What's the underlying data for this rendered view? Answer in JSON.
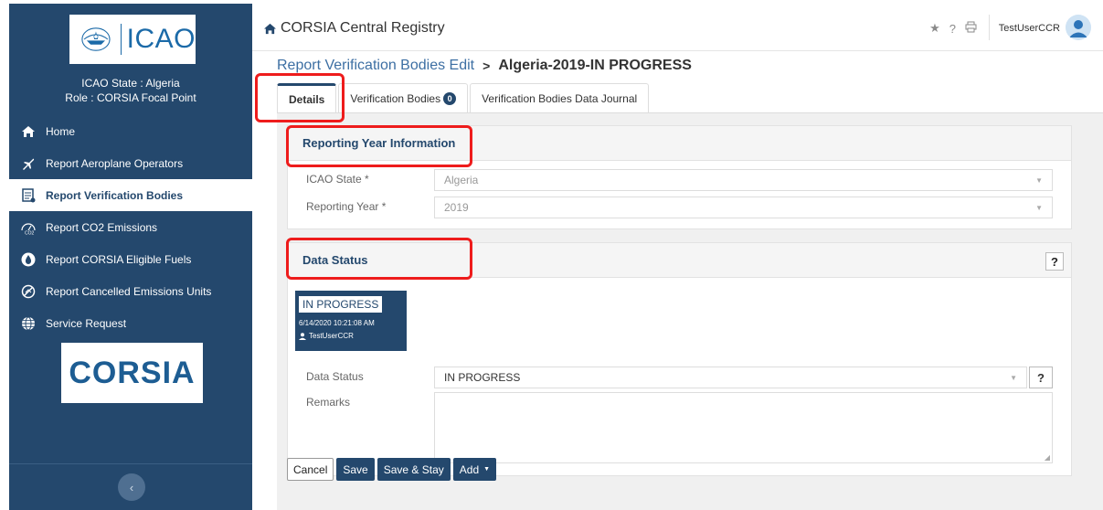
{
  "sidebar": {
    "logo_text": "ICAO",
    "state_line": "ICAO State : Algeria",
    "role_line": "Role : CORSIA Focal Point",
    "items": [
      {
        "label": "Home",
        "icon": "home-icon"
      },
      {
        "label": "Report Aeroplane Operators",
        "icon": "plane-icon"
      },
      {
        "label": "Report Verification Bodies",
        "icon": "report-icon",
        "active": true
      },
      {
        "label": "Report CO2 Emissions",
        "icon": "co2-icon"
      },
      {
        "label": "Report CORSIA Eligible Fuels",
        "icon": "fuel-drop-icon"
      },
      {
        "label": "Report Cancelled Emissions Units",
        "icon": "cancelled-units-icon"
      },
      {
        "label": "Service Request",
        "icon": "globe-icon"
      }
    ],
    "corsia_logo": "CORSIA",
    "collapse_icon": "‹"
  },
  "topbar": {
    "title": "CORSIA Central Registry",
    "icons": [
      "star-icon",
      "help-icon",
      "print-icon"
    ],
    "user": "TestUserCCR"
  },
  "breadcrumb": {
    "link": "Report Verification Bodies Edit",
    "separator": ">",
    "current": "Algeria-2019-IN PROGRESS"
  },
  "tabs": [
    {
      "label": "Details",
      "active": true
    },
    {
      "label": "Verification Bodies",
      "badge": "0"
    },
    {
      "label": "Verification Bodies Data Journal"
    }
  ],
  "reporting_year": {
    "title": "Reporting Year Information",
    "state_label": "ICAO State *",
    "state_value": "Algeria",
    "year_label": "Reporting Year *",
    "year_value": "2019"
  },
  "data_status": {
    "title": "Data Status",
    "help": "?",
    "card_status": "IN PROGRESS",
    "card_time": "6/14/2020 10:21:08 AM",
    "card_user": "TestUserCCR",
    "status_label": "Data Status",
    "status_value": "IN PROGRESS",
    "remarks_label": "Remarks",
    "remarks_value": ""
  },
  "actions": {
    "cancel": "Cancel",
    "save": "Save",
    "save_stay": "Save & Stay",
    "add": "Add"
  },
  "colors": {
    "sidebar": "#24486d",
    "highlight": "#ee1c1c",
    "link": "#3d6fa3"
  }
}
